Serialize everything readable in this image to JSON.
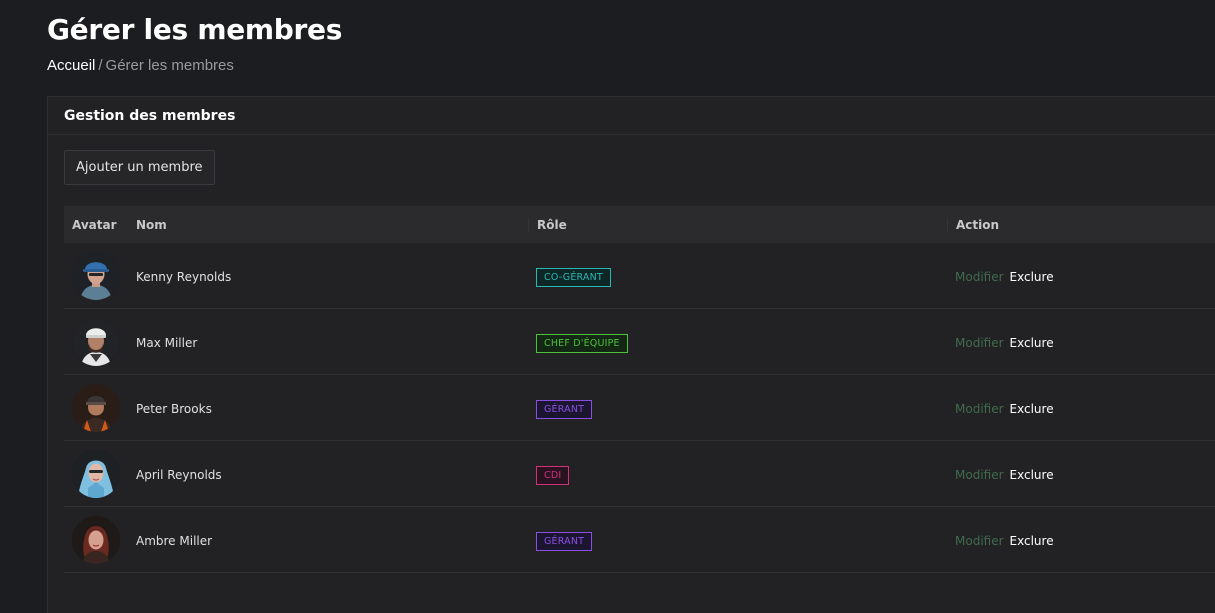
{
  "header": {
    "title": "Gérer les membres"
  },
  "breadcrumb": {
    "home": "Accueil",
    "separator": "/",
    "current": "Gérer les membres"
  },
  "card": {
    "title": "Gestion des membres",
    "add_button_label": "Ajouter un membre"
  },
  "table": {
    "columns": {
      "avatar": "Avatar",
      "name": "Nom",
      "role": "Rôle",
      "action": "Action"
    },
    "actions": {
      "modify": "Modifier",
      "exclude": "Exclure"
    },
    "rows": [
      {
        "name": "Kenny Reynolds",
        "role": "CO-GÉRANT",
        "role_color": "#2ab7b4",
        "role_bg": "#0f2627",
        "avatar_icon": "avatar-blue-cap-icon"
      },
      {
        "name": "Max Miller",
        "role": "CHEF D'ÉQUIPE",
        "role_color": "#4ec13c",
        "role_bg": "#142714",
        "avatar_icon": "avatar-white-cap-icon"
      },
      {
        "name": "Peter Brooks",
        "role": "GÉRANT",
        "role_color": "#8a4fe0",
        "role_bg": "#1c1530",
        "avatar_icon": "avatar-bandana-icon"
      },
      {
        "name": "April Reynolds",
        "role": "CDI",
        "role_color": "#d1317a",
        "role_bg": "#2a1320",
        "avatar_icon": "avatar-blue-hood-icon"
      },
      {
        "name": "Ambre Miller",
        "role": "GÉRANT",
        "role_color": "#8a4fe0",
        "role_bg": "#1c1530",
        "avatar_icon": "avatar-red-hair-icon"
      }
    ]
  }
}
